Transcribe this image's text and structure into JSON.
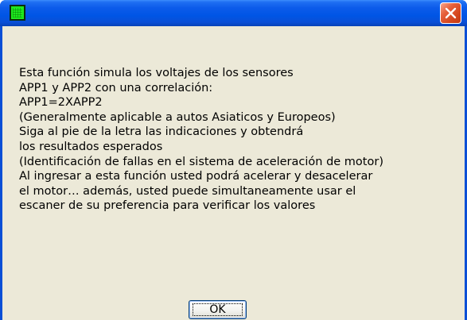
{
  "window": {
    "title": "",
    "app_icon": "app-icon",
    "close_icon": "close-x-icon"
  },
  "dialog": {
    "message_lines": [
      "Esta función simula los voltajes de los sensores",
      "APP1 y APP2 con una correlación:",
      "APP1=2XAPP2",
      "(Generalmente aplicable a autos Asiaticos y Europeos)",
      "Siga al pie de la letra las indicaciones y obtendrá",
      "los resultados esperados",
      "(Identificación de fallas en el sistema de aceleración de motor)",
      "Al ingresar a esta función usted podrá acelerar y desacelerar",
      "el motor… además, usted puede simultaneamente usar el",
      "escaner de su preferencia para verificar los valores"
    ],
    "ok_label": "OK"
  },
  "colors": {
    "titlebar": "#0055e5",
    "close_button": "#d4461e",
    "dialog_background": "#ece9d8",
    "text": "#000000"
  }
}
